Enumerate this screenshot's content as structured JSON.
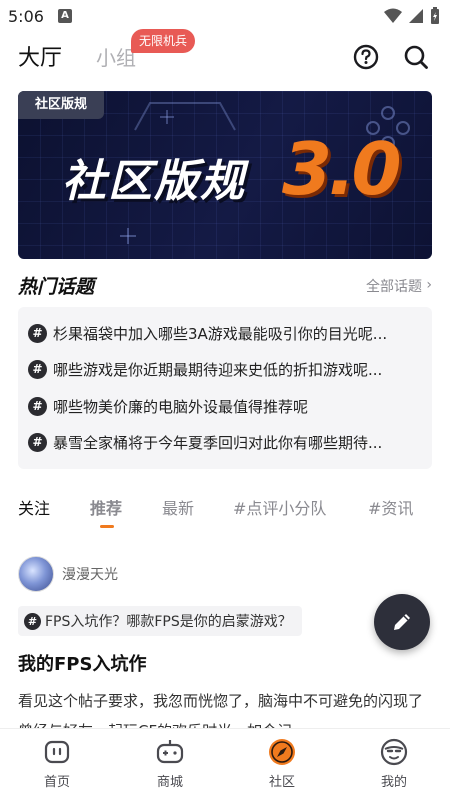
{
  "status_bar": {
    "time": "5:06",
    "notification_letter": "A"
  },
  "top_nav": {
    "tab_hall": "大厅",
    "tab_group": "小组",
    "badge": "无限机兵"
  },
  "banner": {
    "tag": "社区版规",
    "title": "社区版规",
    "number": "3.0"
  },
  "hot_topics": {
    "title": "热门话题",
    "all_link": "全部话题",
    "items": [
      "杉果福袋中加入哪些3A游戏最能吸引你的目光呢...",
      "哪些游戏是你近期最期待迎来史低的折扣游戏呢...",
      "哪些物美价廉的电脑外设最值得推荐呢",
      "暴雪全家桶将于今年夏季回归对此你有哪些期待..."
    ]
  },
  "feed_tabs": [
    "关注",
    "推荐",
    "最新",
    "#点评小分队",
    "#资讯"
  ],
  "post": {
    "author": "漫漫天光",
    "topic": "FPS入坑作？哪款FPS是你的启蒙游戏？",
    "title": "我的FPS入坑作",
    "body": "看见这个帖子要求，我忽而恍惚了，脑海中不可避免的闪现了曾经与好友一起玩CF的欢乐时光，如今记"
  },
  "bottom_nav": [
    "首页",
    "商城",
    "社区",
    "我的"
  ],
  "colors": {
    "accent": "#f07a1e",
    "badge": "#e85a55",
    "fab": "#2d2f3a"
  }
}
